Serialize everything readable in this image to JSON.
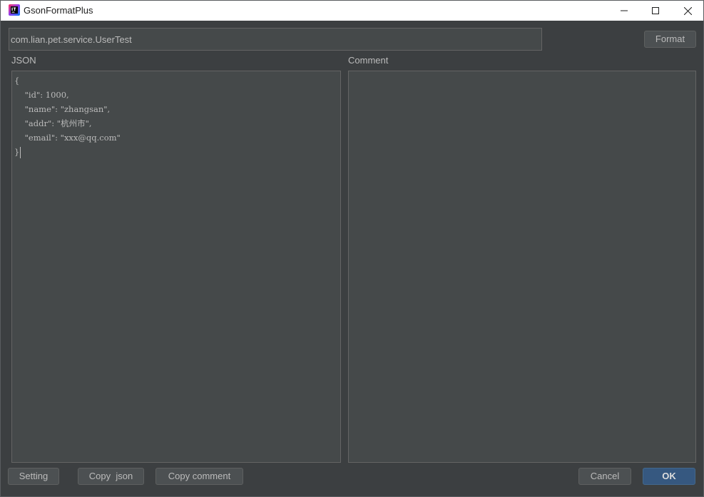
{
  "window": {
    "title": "GsonFormatPlus",
    "icon": "intellij-app-icon"
  },
  "header": {
    "class_name": "com.lian.pet.service.UserTest",
    "format_label": "Format"
  },
  "json_panel": {
    "label": "JSON",
    "lines": [
      "{",
      "    \"id\": 1000,",
      "    \"name\": \"zhangsan\",",
      "    \"addr\": \"杭州市\",",
      "    \"email\": \"xxx@qq.com\"",
      "}"
    ]
  },
  "comment_panel": {
    "label": "Comment"
  },
  "footer": {
    "setting_label": "Setting",
    "copy_json_label": "Copy  json",
    "copy_comment_label": "Copy comment",
    "cancel_label": "Cancel",
    "ok_label": "OK"
  },
  "colors": {
    "background": "#3c3f41",
    "field": "#45494a",
    "text": "#bbbbbb",
    "primary_button": "#365880"
  }
}
